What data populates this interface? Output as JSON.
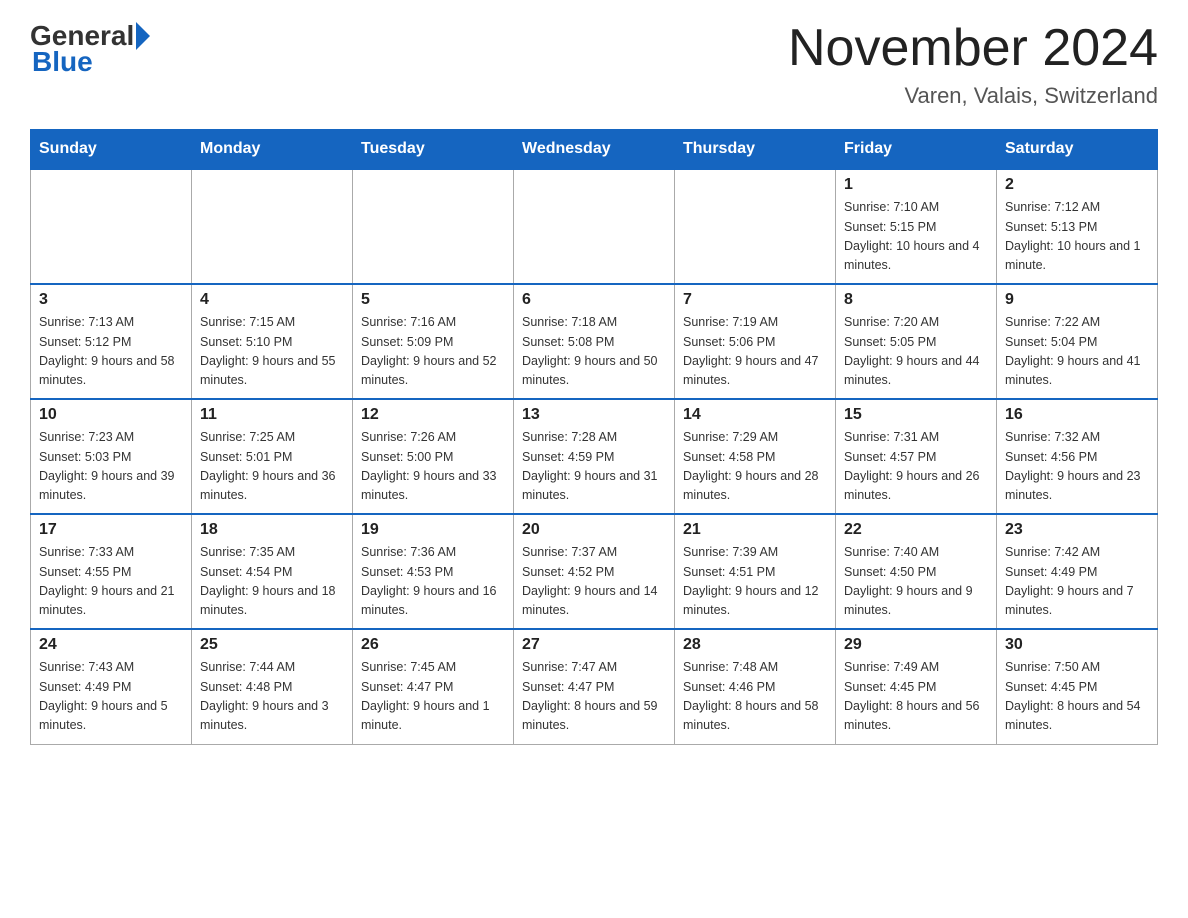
{
  "logo": {
    "general": "General",
    "triangle": "",
    "blue": "Blue"
  },
  "header": {
    "month_year": "November 2024",
    "location": "Varen, Valais, Switzerland"
  },
  "weekdays": [
    "Sunday",
    "Monday",
    "Tuesday",
    "Wednesday",
    "Thursday",
    "Friday",
    "Saturday"
  ],
  "weeks": [
    [
      {
        "day": "",
        "info": ""
      },
      {
        "day": "",
        "info": ""
      },
      {
        "day": "",
        "info": ""
      },
      {
        "day": "",
        "info": ""
      },
      {
        "day": "",
        "info": ""
      },
      {
        "day": "1",
        "info": "Sunrise: 7:10 AM\nSunset: 5:15 PM\nDaylight: 10 hours and 4 minutes."
      },
      {
        "day": "2",
        "info": "Sunrise: 7:12 AM\nSunset: 5:13 PM\nDaylight: 10 hours and 1 minute."
      }
    ],
    [
      {
        "day": "3",
        "info": "Sunrise: 7:13 AM\nSunset: 5:12 PM\nDaylight: 9 hours and 58 minutes."
      },
      {
        "day": "4",
        "info": "Sunrise: 7:15 AM\nSunset: 5:10 PM\nDaylight: 9 hours and 55 minutes."
      },
      {
        "day": "5",
        "info": "Sunrise: 7:16 AM\nSunset: 5:09 PM\nDaylight: 9 hours and 52 minutes."
      },
      {
        "day": "6",
        "info": "Sunrise: 7:18 AM\nSunset: 5:08 PM\nDaylight: 9 hours and 50 minutes."
      },
      {
        "day": "7",
        "info": "Sunrise: 7:19 AM\nSunset: 5:06 PM\nDaylight: 9 hours and 47 minutes."
      },
      {
        "day": "8",
        "info": "Sunrise: 7:20 AM\nSunset: 5:05 PM\nDaylight: 9 hours and 44 minutes."
      },
      {
        "day": "9",
        "info": "Sunrise: 7:22 AM\nSunset: 5:04 PM\nDaylight: 9 hours and 41 minutes."
      }
    ],
    [
      {
        "day": "10",
        "info": "Sunrise: 7:23 AM\nSunset: 5:03 PM\nDaylight: 9 hours and 39 minutes."
      },
      {
        "day": "11",
        "info": "Sunrise: 7:25 AM\nSunset: 5:01 PM\nDaylight: 9 hours and 36 minutes."
      },
      {
        "day": "12",
        "info": "Sunrise: 7:26 AM\nSunset: 5:00 PM\nDaylight: 9 hours and 33 minutes."
      },
      {
        "day": "13",
        "info": "Sunrise: 7:28 AM\nSunset: 4:59 PM\nDaylight: 9 hours and 31 minutes."
      },
      {
        "day": "14",
        "info": "Sunrise: 7:29 AM\nSunset: 4:58 PM\nDaylight: 9 hours and 28 minutes."
      },
      {
        "day": "15",
        "info": "Sunrise: 7:31 AM\nSunset: 4:57 PM\nDaylight: 9 hours and 26 minutes."
      },
      {
        "day": "16",
        "info": "Sunrise: 7:32 AM\nSunset: 4:56 PM\nDaylight: 9 hours and 23 minutes."
      }
    ],
    [
      {
        "day": "17",
        "info": "Sunrise: 7:33 AM\nSunset: 4:55 PM\nDaylight: 9 hours and 21 minutes."
      },
      {
        "day": "18",
        "info": "Sunrise: 7:35 AM\nSunset: 4:54 PM\nDaylight: 9 hours and 18 minutes."
      },
      {
        "day": "19",
        "info": "Sunrise: 7:36 AM\nSunset: 4:53 PM\nDaylight: 9 hours and 16 minutes."
      },
      {
        "day": "20",
        "info": "Sunrise: 7:37 AM\nSunset: 4:52 PM\nDaylight: 9 hours and 14 minutes."
      },
      {
        "day": "21",
        "info": "Sunrise: 7:39 AM\nSunset: 4:51 PM\nDaylight: 9 hours and 12 minutes."
      },
      {
        "day": "22",
        "info": "Sunrise: 7:40 AM\nSunset: 4:50 PM\nDaylight: 9 hours and 9 minutes."
      },
      {
        "day": "23",
        "info": "Sunrise: 7:42 AM\nSunset: 4:49 PM\nDaylight: 9 hours and 7 minutes."
      }
    ],
    [
      {
        "day": "24",
        "info": "Sunrise: 7:43 AM\nSunset: 4:49 PM\nDaylight: 9 hours and 5 minutes."
      },
      {
        "day": "25",
        "info": "Sunrise: 7:44 AM\nSunset: 4:48 PM\nDaylight: 9 hours and 3 minutes."
      },
      {
        "day": "26",
        "info": "Sunrise: 7:45 AM\nSunset: 4:47 PM\nDaylight: 9 hours and 1 minute."
      },
      {
        "day": "27",
        "info": "Sunrise: 7:47 AM\nSunset: 4:47 PM\nDaylight: 8 hours and 59 minutes."
      },
      {
        "day": "28",
        "info": "Sunrise: 7:48 AM\nSunset: 4:46 PM\nDaylight: 8 hours and 58 minutes."
      },
      {
        "day": "29",
        "info": "Sunrise: 7:49 AM\nSunset: 4:45 PM\nDaylight: 8 hours and 56 minutes."
      },
      {
        "day": "30",
        "info": "Sunrise: 7:50 AM\nSunset: 4:45 PM\nDaylight: 8 hours and 54 minutes."
      }
    ]
  ]
}
